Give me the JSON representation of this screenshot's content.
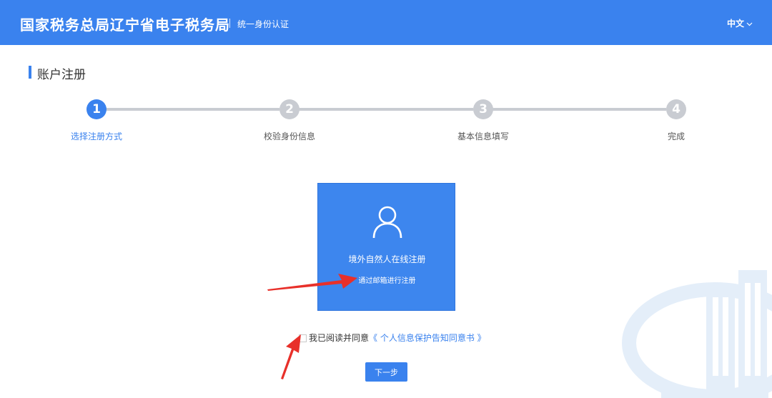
{
  "header": {
    "brand": "国家税务总局辽宁省电子税务局",
    "subtitle": "统一身份认证",
    "language": "中文"
  },
  "page": {
    "title": "账户注册"
  },
  "steps": [
    {
      "number": "1",
      "label": "选择注册方式",
      "active": true
    },
    {
      "number": "2",
      "label": "校验身份信息",
      "active": false
    },
    {
      "number": "3",
      "label": "基本信息填写",
      "active": false
    },
    {
      "number": "4",
      "label": "完成",
      "active": false
    }
  ],
  "option_card": {
    "icon": "user-icon",
    "title": "境外自然人在线注册",
    "subtitle": "通过邮箱进行注册"
  },
  "agreement": {
    "text": "我已阅读并同意",
    "link": "《 个人信息保护告知同意书 》"
  },
  "next_button": "下一步",
  "colors": {
    "primary": "#3a82ee",
    "inactive_step": "#c9ccd2",
    "annotation": "#e8302a"
  }
}
